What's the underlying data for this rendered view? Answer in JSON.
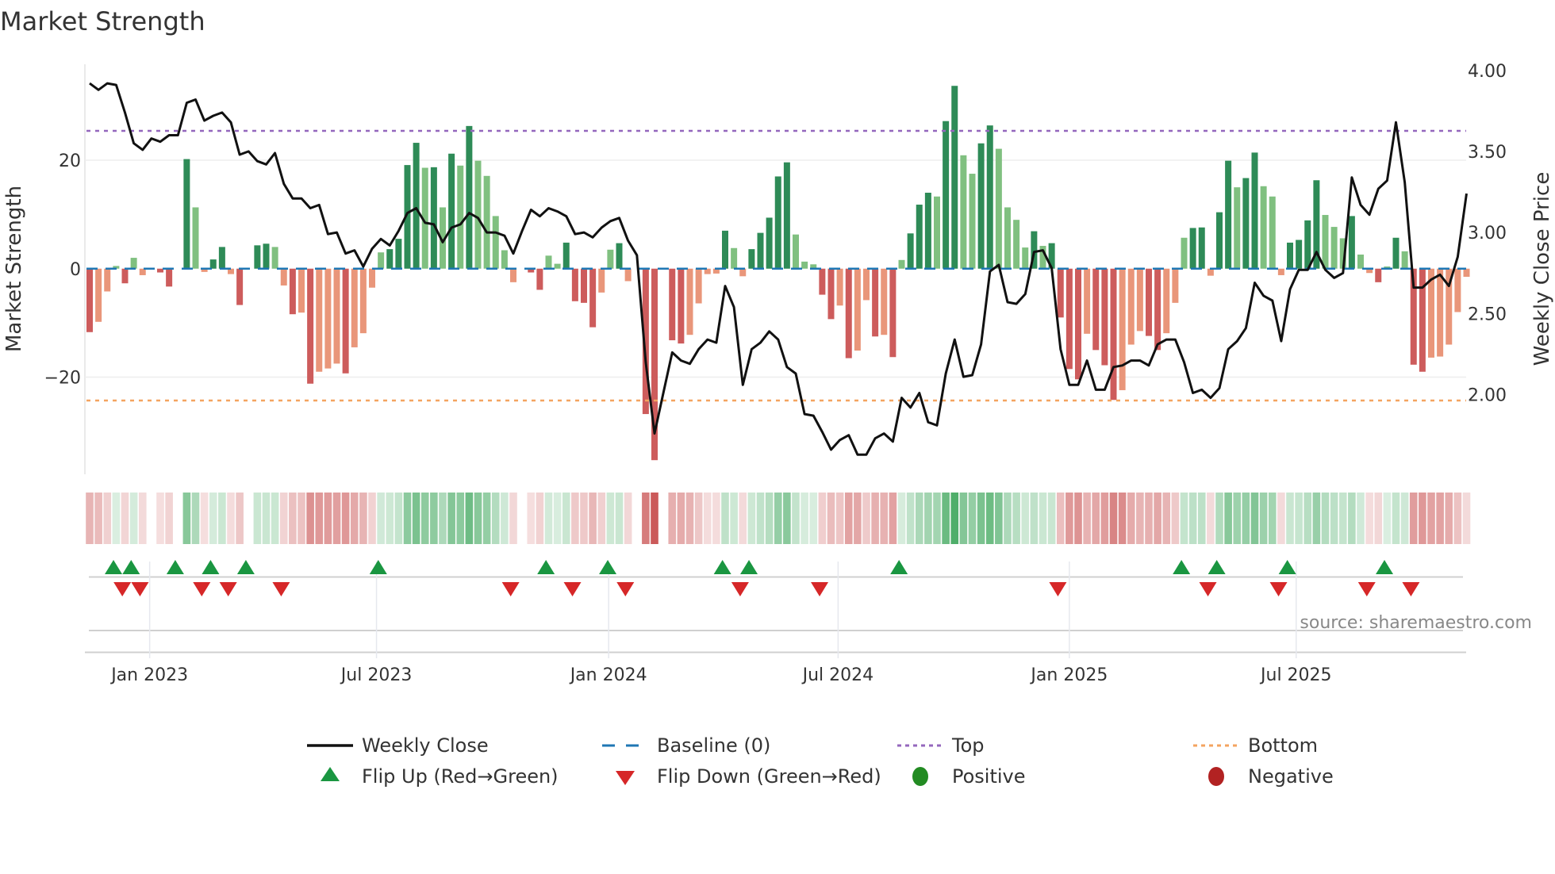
{
  "chart_data": {
    "type": "bar",
    "title": "Market Strength",
    "ylabel": "Market Strength",
    "y2label": "Weekly Close Price",
    "ylim": [
      -38,
      38
    ],
    "y2lim": [
      1.5,
      4.0
    ],
    "y_ticks": [
      {
        "value": 20,
        "label": "20"
      },
      {
        "value": 0,
        "label": "0"
      },
      {
        "value": -20,
        "label": "−20"
      }
    ],
    "y2_ticks": [
      {
        "value": 4.0,
        "label": "4.00"
      },
      {
        "value": 3.5,
        "label": "3.50"
      },
      {
        "value": 3.0,
        "label": "3.00"
      },
      {
        "value": 2.5,
        "label": "2.50"
      },
      {
        "value": 2.0,
        "label": "2.00"
      }
    ],
    "x_unit": "week index",
    "x_ticks": [
      {
        "week": 6.8,
        "label": "Jan 2023"
      },
      {
        "week": 32.5,
        "label": "Jul 2023"
      },
      {
        "week": 58.8,
        "label": "Jan 2024"
      },
      {
        "week": 84.8,
        "label": "Jul 2024"
      },
      {
        "week": 111,
        "label": "Jan 2025"
      },
      {
        "week": 136.7,
        "label": "Jul 2025"
      }
    ],
    "top_level": 25.4,
    "bottom_level": -24.3,
    "strength": [
      -11.7,
      -9.8,
      -4.2,
      0.5,
      -2.7,
      2,
      -1.2,
      0,
      -0.7,
      -3.3,
      0,
      20.2,
      11.3,
      -0.6,
      1.7,
      4,
      -1,
      -6.7,
      0,
      4.3,
      4.6,
      4,
      -3.1,
      -8.4,
      -8.1,
      -21.2,
      -19,
      -18.4,
      -17.5,
      -19.3,
      -14.5,
      -11.9,
      -3.5,
      3,
      3.6,
      5.5,
      19.1,
      23.2,
      18.6,
      18.7,
      11.3,
      21.2,
      19,
      26.3,
      19.9,
      17.1,
      9.7,
      3.4,
      -2.5,
      0,
      -0.7,
      -3.9,
      2.4,
      0.9,
      4.8,
      -6,
      -6.3,
      -10.8,
      -4.4,
      3.5,
      4.7,
      -2.3,
      0,
      -26.8,
      -35.3,
      0,
      -13.2,
      -13.8,
      -12.2,
      -6.4,
      -1,
      -0.9,
      7,
      3.8,
      -1.4,
      3.6,
      6.6,
      9.4,
      17,
      19.6,
      6.3,
      1.3,
      0.8,
      -4.8,
      -9.3,
      -6.8,
      -16.5,
      -15.1,
      -5.8,
      -12.5,
      -12.2,
      -16.3,
      1.6,
      6.5,
      11.8,
      14,
      13.3,
      27.2,
      33.7,
      20.9,
      17.5,
      23.1,
      26.4,
      22.1,
      11.3,
      9,
      3.9,
      6.9,
      4.2,
      4.7,
      -9,
      -18.5,
      -20.4,
      -12,
      -15,
      -17.8,
      -24.2,
      -22.4,
      -14,
      -11.5,
      -12.4,
      -15,
      -11.9,
      -6.3,
      5.7,
      7.5,
      7.6,
      -1.3,
      10.4,
      19.9,
      15,
      16.7,
      21.4,
      15.2,
      13.3,
      -1.2,
      4.8,
      5.3,
      8.9,
      16.3,
      9.9,
      7.7,
      5.6,
      9.7,
      2.6,
      -0.8,
      -2.5,
      0.4,
      5.7,
      3.2,
      -17.7,
      -19,
      -16.4,
      -16.2,
      -14,
      -8,
      -1.5
    ],
    "weekly_close": [
      3.92,
      3.88,
      3.92,
      3.91,
      3.74,
      3.55,
      3.51,
      3.58,
      3.56,
      3.6,
      3.6,
      3.8,
      3.82,
      3.69,
      3.72,
      3.74,
      3.68,
      3.48,
      3.5,
      3.44,
      3.42,
      3.49,
      3.3,
      3.21,
      3.21,
      3.15,
      3.17,
      2.99,
      3.0,
      2.87,
      2.89,
      2.79,
      2.9,
      2.96,
      2.92,
      3.01,
      3.12,
      3.15,
      3.06,
      3.05,
      2.94,
      3.03,
      3.05,
      3.12,
      3.09,
      3.0,
      3.0,
      2.98,
      2.87,
      3.01,
      3.14,
      3.1,
      3.15,
      3.13,
      3.1,
      2.99,
      3.0,
      2.97,
      3.03,
      3.07,
      3.09,
      2.95,
      2.86,
      2.2,
      1.76,
      2.01,
      2.26,
      2.21,
      2.19,
      2.28,
      2.34,
      2.32,
      2.67,
      2.54,
      2.06,
      2.28,
      2.32,
      2.39,
      2.34,
      2.17,
      2.13,
      1.88,
      1.87,
      1.77,
      1.66,
      1.72,
      1.75,
      1.63,
      1.63,
      1.73,
      1.76,
      1.71,
      1.98,
      1.92,
      2.01,
      1.83,
      1.81,
      2.13,
      2.34,
      2.11,
      2.12,
      2.31,
      2.76,
      2.8,
      2.57,
      2.56,
      2.62,
      2.88,
      2.89,
      2.78,
      2.28,
      2.06,
      2.06,
      2.21,
      2.03,
      2.03,
      2.17,
      2.18,
      2.21,
      2.21,
      2.18,
      2.31,
      2.34,
      2.34,
      2.2,
      2.01,
      2.03,
      1.98,
      2.04,
      2.28,
      2.33,
      2.41,
      2.69,
      2.61,
      2.58,
      2.33,
      2.65,
      2.77,
      2.77,
      2.88,
      2.77,
      2.72,
      2.75,
      3.34,
      3.17,
      3.11,
      3.27,
      3.32,
      3.68,
      3.31,
      2.66,
      2.66,
      2.71,
      2.74,
      2.67,
      2.85,
      3.24
    ],
    "flip_up_weeks": [
      3,
      5,
      10,
      14,
      18,
      33,
      52,
      59,
      72,
      75,
      92,
      124,
      128,
      136,
      147
    ],
    "flip_down_weeks": [
      4,
      6,
      13,
      16,
      22,
      48,
      55,
      61,
      74,
      83,
      110,
      127,
      135,
      145,
      150
    ],
    "legend": {
      "placement": "bottom",
      "items": [
        {
          "key": "close",
          "label": "Weekly Close"
        },
        {
          "key": "baseline",
          "label": "Baseline (0)"
        },
        {
          "key": "top",
          "label": "Top"
        },
        {
          "key": "bottom",
          "label": "Bottom"
        },
        {
          "key": "flip_up",
          "label": "Flip Up (Red→Green)"
        },
        {
          "key": "flip_down",
          "label": "Flip Down (Green→Red)"
        },
        {
          "key": "positive",
          "label": "Positive"
        },
        {
          "key": "negative",
          "label": "Negative"
        }
      ]
    },
    "source": "source: sharemaestro.com"
  },
  "colors": {
    "pos_strong": "#2e8b57",
    "pos_weak": "#80c080",
    "neg_strong": "#cd5c5c",
    "neg_weak": "#e9967a",
    "close": "#111111",
    "baseline": "#1f77b4",
    "top": "#9467bd",
    "bottom": "#f4a460",
    "flip_up": "#1a9641",
    "flip_down": "#d62728",
    "positive": "#228b22",
    "negative": "#b22222"
  }
}
